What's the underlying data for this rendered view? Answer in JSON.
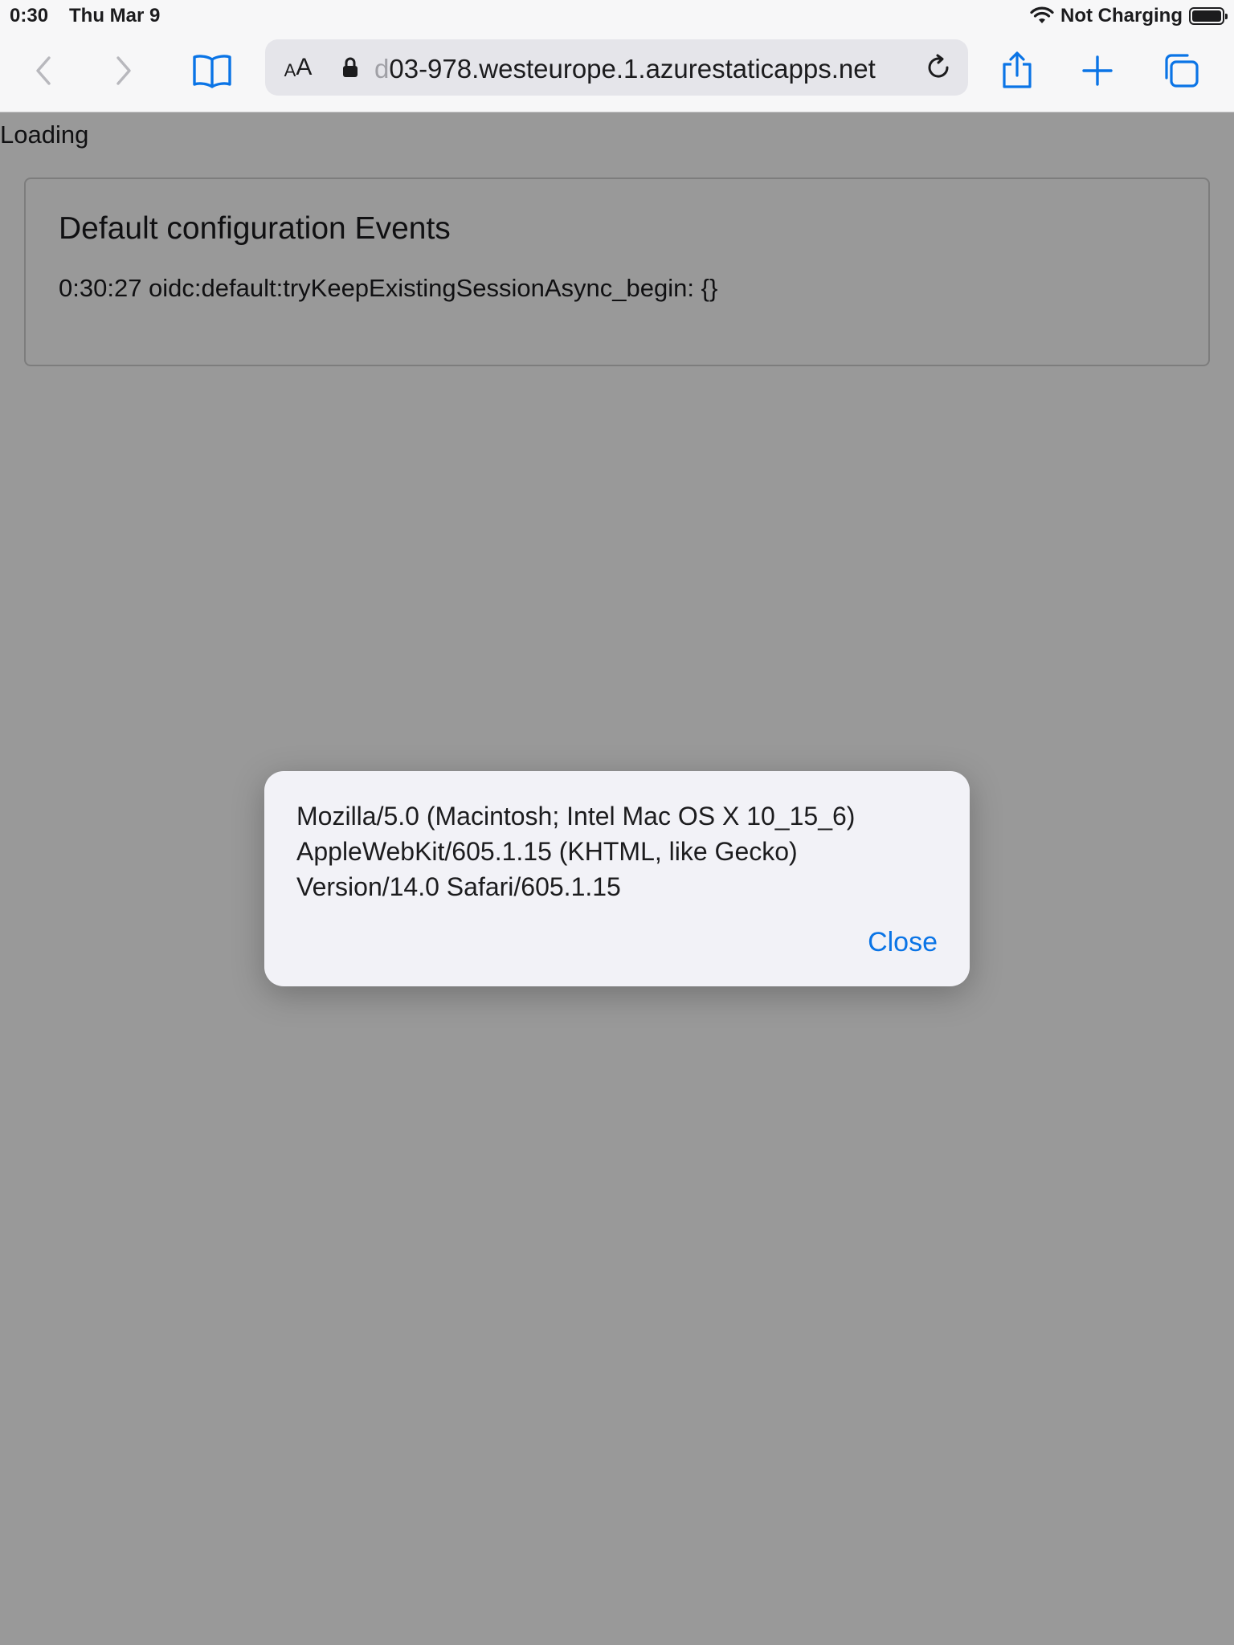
{
  "status_bar": {
    "time": "0:30",
    "date": "Thu Mar 9",
    "charging_status": "Not Charging",
    "icons": [
      "wifi-icon",
      "battery-icon"
    ]
  },
  "toolbar": {
    "icons": [
      "back-icon",
      "forward-icon",
      "bookmarks-icon",
      "share-icon",
      "add-tab-icon",
      "tabs-icon"
    ],
    "text_size_label_small": "A",
    "text_size_label_large": "A",
    "url_dim_prefix": "d",
    "url": "03-978.westeurope.1.azurestaticapps.net",
    "lock_icon": "lock-icon",
    "reload_icon": "reload-icon"
  },
  "page": {
    "loading_text": "Loading",
    "events_card": {
      "title": "Default configuration Events",
      "events": [
        "0:30:27 oidc:default:tryKeepExistingSessionAsync_begin: {}"
      ]
    }
  },
  "alert": {
    "message": "Mozilla/5.0 (Macintosh; Intel Mac OS X 10_15_6) AppleWebKit/605.1.15 (KHTML, like Gecko) Version/14.0 Safari/605.1.15",
    "close_label": "Close"
  },
  "colors": {
    "accent": "#0a74e6",
    "disabled": "#b8b8bd",
    "toolbar_bg": "#f7f7f8",
    "address_bg": "#e5e5ea",
    "overlay": "rgba(0,0,0,0.4)"
  }
}
